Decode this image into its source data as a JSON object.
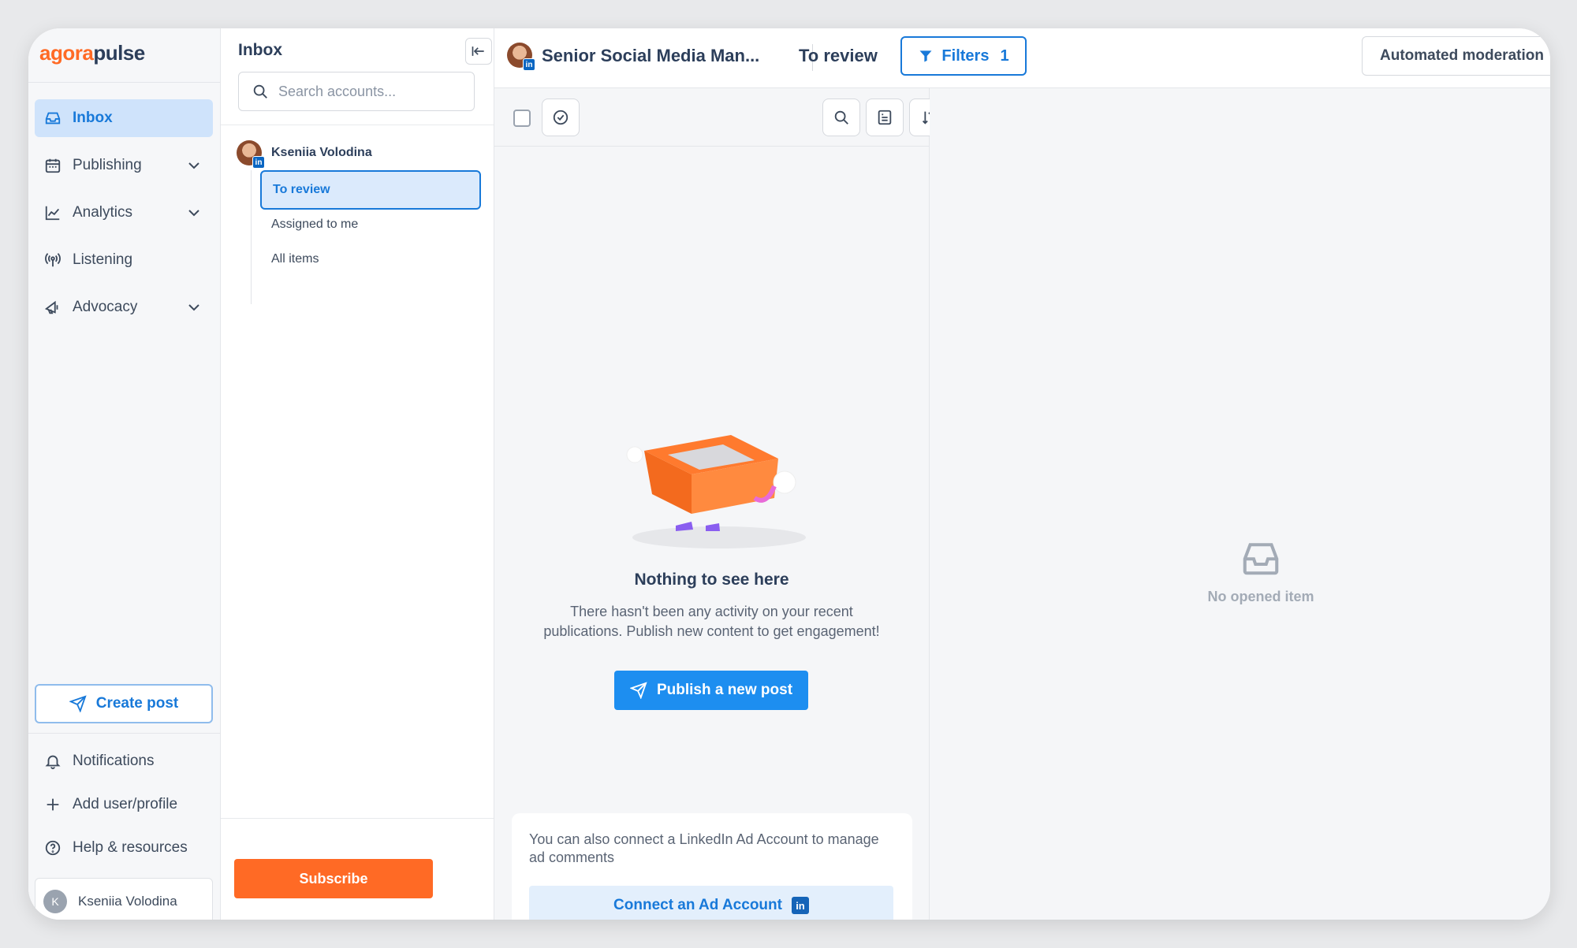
{
  "brand": {
    "part1": "agora",
    "part2": "pulse"
  },
  "nav": {
    "items": [
      {
        "label": "Inbox"
      },
      {
        "label": "Publishing"
      },
      {
        "label": "Analytics"
      },
      {
        "label": "Listening"
      },
      {
        "label": "Advocacy"
      }
    ],
    "create_post": "Create post",
    "bottom": [
      {
        "label": "Notifications"
      },
      {
        "label": "Add user/profile"
      },
      {
        "label": "Help & resources"
      }
    ],
    "profile": {
      "initial": "K",
      "name": "Kseniia Volodina"
    }
  },
  "inbox_panel": {
    "title": "Inbox",
    "search_placeholder": "Search accounts...",
    "account": {
      "name": "Kseniia Volodina",
      "network_badge": "in"
    },
    "sub_items": [
      {
        "label": "To review"
      },
      {
        "label": "Assigned to me"
      },
      {
        "label": "All items"
      }
    ],
    "subscribe": "Subscribe"
  },
  "topbar": {
    "title": "Senior Social Media Man...",
    "view": "To review",
    "filters_label": "Filters",
    "filters_count": "1",
    "automated": "Automated moderation"
  },
  "empty_state": {
    "title": "Nothing to see here",
    "text": "There hasn't been any activity on your recent publications. Publish new content to get engagement!",
    "button": "Publish a new post"
  },
  "ad_card": {
    "text": "You can also connect a LinkedIn Ad Account to manage ad comments",
    "button": "Connect an Ad Account",
    "badge": "in"
  },
  "detail": {
    "empty_label": "No opened item"
  },
  "colors": {
    "accent": "#1879d9",
    "brand_orange": "#ff6a25",
    "linkedin": "#0a66c2"
  }
}
